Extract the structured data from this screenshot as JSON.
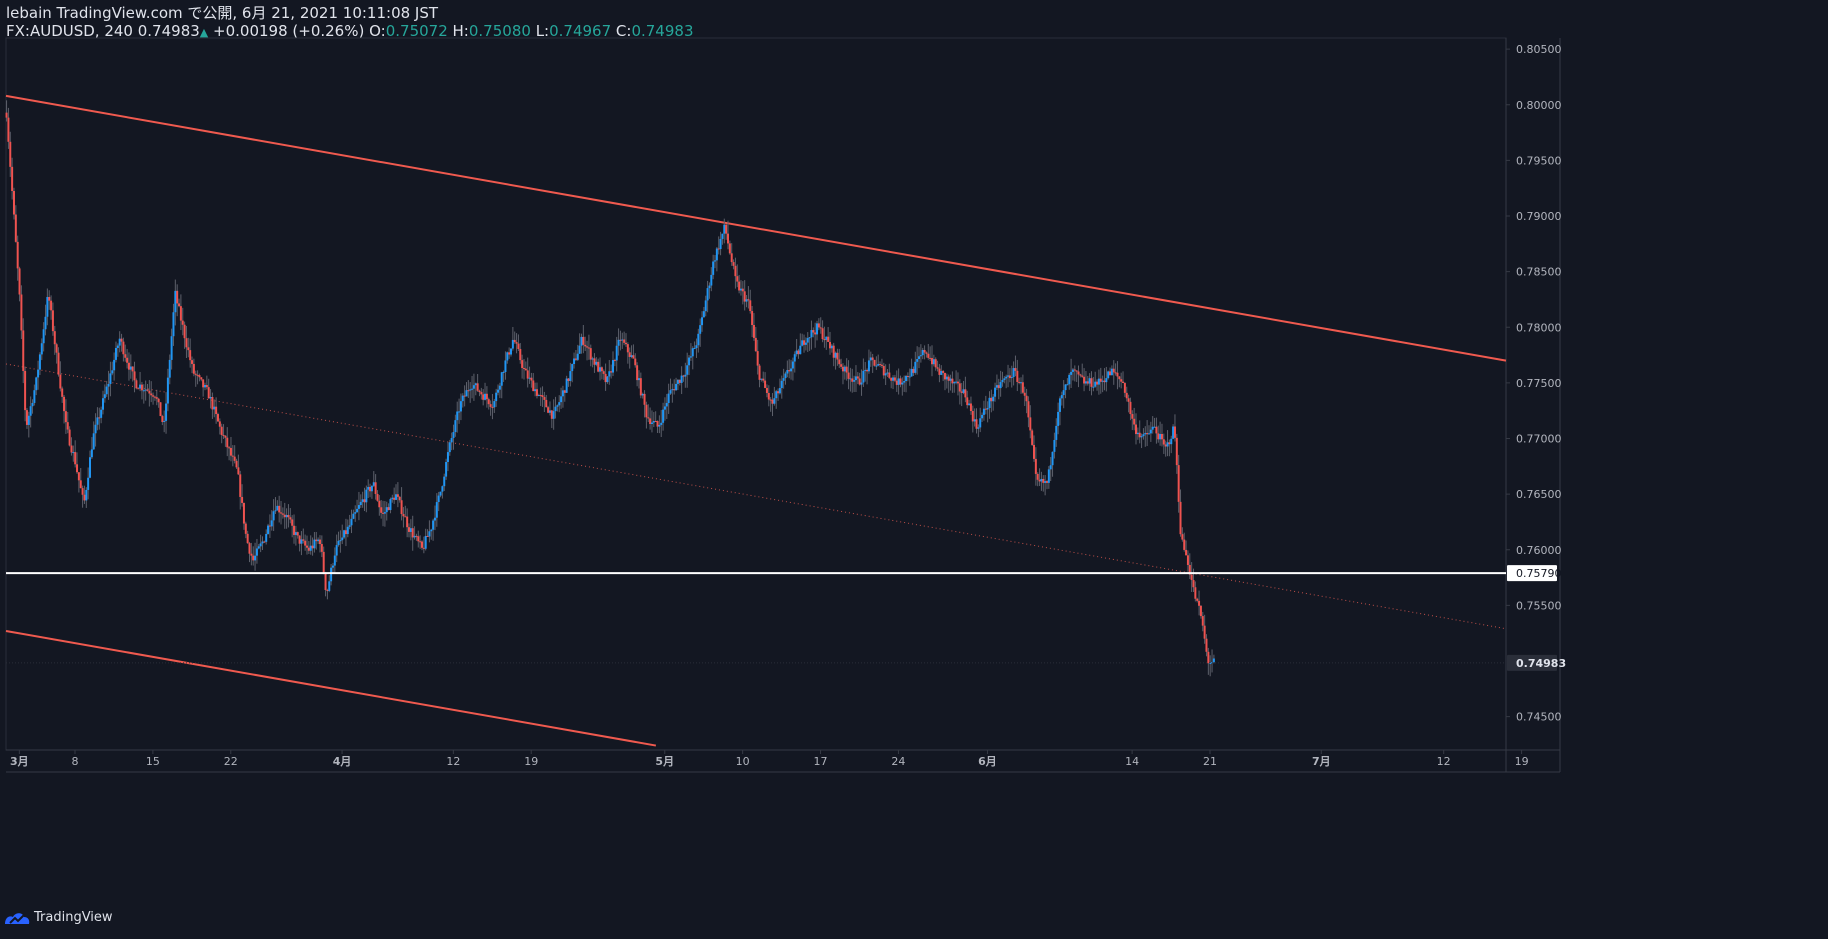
{
  "header": {
    "line1": "lebain TradingView.com で公開, 6月 21, 2021 10:11:08 JST",
    "symbol": "FX:AUDUSD, 240",
    "last": "0.74983",
    "change": "+0.00198 (+0.26%)",
    "o_label": "O:",
    "o_value": "0.75072",
    "h_label": "H:",
    "h_value": "0.75080",
    "l_label": "L:",
    "l_value": "0.74967",
    "c_label": "C:",
    "c_value": "0.74983"
  },
  "footer": {
    "brand": "TradingView"
  },
  "colors": {
    "background": "#131722",
    "up": "#2196f3",
    "down": "#ef5350",
    "trendline": "#f05a4f",
    "hline": "#ffffff",
    "axis_text": "#b2b5be"
  },
  "chart_data": {
    "type": "candlestick",
    "symbol": "FX:AUDUSD",
    "interval": "240",
    "ylim": [
      0.742,
      0.806
    ],
    "y_ticks": [
      "0.80500",
      "0.80000",
      "0.79500",
      "0.79000",
      "0.78500",
      "0.78000",
      "0.77500",
      "0.77000",
      "0.76500",
      "0.76000",
      "0.75500",
      "0.74500"
    ],
    "x_ticks": [
      {
        "label": "3月",
        "day": 0
      },
      {
        "label": "8",
        "day": 5
      },
      {
        "label": "15",
        "day": 12
      },
      {
        "label": "22",
        "day": 19
      },
      {
        "label": "4月",
        "day": 29
      },
      {
        "label": "12",
        "day": 39
      },
      {
        "label": "19",
        "day": 46
      },
      {
        "label": "5月",
        "day": 58
      },
      {
        "label": "10",
        "day": 65
      },
      {
        "label": "17",
        "day": 72
      },
      {
        "label": "24",
        "day": 79
      },
      {
        "label": "6月",
        "day": 87
      },
      {
        "label": "14",
        "day": 100
      },
      {
        "label": "21",
        "day": 107
      },
      {
        "label": "7月",
        "day": 117
      },
      {
        "label": "12",
        "day": 128
      },
      {
        "label": "19",
        "day": 135
      }
    ],
    "x_range_days": [
      -1.2,
      133.6
    ],
    "price_path": [
      {
        "day": -1.2,
        "p": 0.8
      },
      {
        "day": 0,
        "p": 0.783
      },
      {
        "day": 0.6,
        "p": 0.771
      },
      {
        "day": 1.5,
        "p": 0.775
      },
      {
        "day": 2.6,
        "p": 0.783
      },
      {
        "day": 3.4,
        "p": 0.777
      },
      {
        "day": 4.2,
        "p": 0.771
      },
      {
        "day": 5.0,
        "p": 0.768
      },
      {
        "day": 5.8,
        "p": 0.764
      },
      {
        "day": 6.6,
        "p": 0.77
      },
      {
        "day": 8.0,
        "p": 0.775
      },
      {
        "day": 9.0,
        "p": 0.779
      },
      {
        "day": 10.4,
        "p": 0.775
      },
      {
        "day": 12.2,
        "p": 0.774
      },
      {
        "day": 13.0,
        "p": 0.771
      },
      {
        "day": 14.0,
        "p": 0.783
      },
      {
        "day": 15.6,
        "p": 0.776
      },
      {
        "day": 17.0,
        "p": 0.774
      },
      {
        "day": 18.0,
        "p": 0.771
      },
      {
        "day": 19.6,
        "p": 0.767
      },
      {
        "day": 20.4,
        "p": 0.761
      },
      {
        "day": 21.0,
        "p": 0.759
      },
      {
        "day": 22.0,
        "p": 0.761
      },
      {
        "day": 23.0,
        "p": 0.764
      },
      {
        "day": 24.0,
        "p": 0.763
      },
      {
        "day": 25.0,
        "p": 0.761
      },
      {
        "day": 26.0,
        "p": 0.76
      },
      {
        "day": 27.0,
        "p": 0.761
      },
      {
        "day": 27.6,
        "p": 0.756
      },
      {
        "day": 28.4,
        "p": 0.76
      },
      {
        "day": 29.6,
        "p": 0.762
      },
      {
        "day": 30.6,
        "p": 0.764
      },
      {
        "day": 31.8,
        "p": 0.766
      },
      {
        "day": 32.6,
        "p": 0.763
      },
      {
        "day": 33.8,
        "p": 0.765
      },
      {
        "day": 35.0,
        "p": 0.762
      },
      {
        "day": 36.2,
        "p": 0.76
      },
      {
        "day": 37.0,
        "p": 0.762
      },
      {
        "day": 37.8,
        "p": 0.765
      },
      {
        "day": 38.6,
        "p": 0.769
      },
      {
        "day": 39.6,
        "p": 0.773
      },
      {
        "day": 40.6,
        "p": 0.775
      },
      {
        "day": 41.6,
        "p": 0.774
      },
      {
        "day": 42.6,
        "p": 0.773
      },
      {
        "day": 43.4,
        "p": 0.776
      },
      {
        "day": 44.4,
        "p": 0.779
      },
      {
        "day": 45.4,
        "p": 0.776
      },
      {
        "day": 46.6,
        "p": 0.774
      },
      {
        "day": 48.0,
        "p": 0.772
      },
      {
        "day": 49.2,
        "p": 0.775
      },
      {
        "day": 50.6,
        "p": 0.779
      },
      {
        "day": 51.6,
        "p": 0.777
      },
      {
        "day": 52.8,
        "p": 0.775
      },
      {
        "day": 54.0,
        "p": 0.779
      },
      {
        "day": 55.2,
        "p": 0.777
      },
      {
        "day": 56.4,
        "p": 0.772
      },
      {
        "day": 57.4,
        "p": 0.771
      },
      {
        "day": 58.4,
        "p": 0.774
      },
      {
        "day": 59.8,
        "p": 0.776
      },
      {
        "day": 61.0,
        "p": 0.779
      },
      {
        "day": 62.4,
        "p": 0.786
      },
      {
        "day": 63.4,
        "p": 0.789
      },
      {
        "day": 64.4,
        "p": 0.784
      },
      {
        "day": 65.6,
        "p": 0.782
      },
      {
        "day": 66.4,
        "p": 0.776
      },
      {
        "day": 67.6,
        "p": 0.773
      },
      {
        "day": 68.6,
        "p": 0.775
      },
      {
        "day": 69.6,
        "p": 0.777
      },
      {
        "day": 70.6,
        "p": 0.779
      },
      {
        "day": 71.8,
        "p": 0.78
      },
      {
        "day": 73.0,
        "p": 0.778
      },
      {
        "day": 74.2,
        "p": 0.776
      },
      {
        "day": 75.4,
        "p": 0.775
      },
      {
        "day": 76.6,
        "p": 0.777
      },
      {
        "day": 77.8,
        "p": 0.776
      },
      {
        "day": 79.0,
        "p": 0.775
      },
      {
        "day": 80.2,
        "p": 0.776
      },
      {
        "day": 81.4,
        "p": 0.778
      },
      {
        "day": 82.6,
        "p": 0.776
      },
      {
        "day": 83.8,
        "p": 0.775
      },
      {
        "day": 85.0,
        "p": 0.774
      },
      {
        "day": 86.0,
        "p": 0.771
      },
      {
        "day": 87.0,
        "p": 0.773
      },
      {
        "day": 88.2,
        "p": 0.775
      },
      {
        "day": 89.4,
        "p": 0.776
      },
      {
        "day": 90.4,
        "p": 0.774
      },
      {
        "day": 91.4,
        "p": 0.766
      },
      {
        "day": 92.4,
        "p": 0.766
      },
      {
        "day": 93.4,
        "p": 0.773
      },
      {
        "day": 94.6,
        "p": 0.776
      },
      {
        "day": 95.8,
        "p": 0.775
      },
      {
        "day": 97.0,
        "p": 0.775
      },
      {
        "day": 98.2,
        "p": 0.776
      },
      {
        "day": 99.2,
        "p": 0.775
      },
      {
        "day": 100.2,
        "p": 0.771
      },
      {
        "day": 101.0,
        "p": 0.77
      },
      {
        "day": 102.0,
        "p": 0.771
      },
      {
        "day": 103.0,
        "p": 0.769
      },
      {
        "day": 103.8,
        "p": 0.771
      },
      {
        "day": 104.4,
        "p": 0.761
      },
      {
        "day": 105.0,
        "p": 0.759
      },
      {
        "day": 105.6,
        "p": 0.756
      },
      {
        "day": 106.2,
        "p": 0.754
      },
      {
        "day": 106.8,
        "p": 0.75
      },
      {
        "day": 107.4,
        "p": 0.74983
      }
    ],
    "trendlines": [
      {
        "style": "solid",
        "from": {
          "day": -1.2,
          "p": 0.8008
        },
        "to": {
          "day": 133.6,
          "p": 0.777
        }
      },
      {
        "style": "solid",
        "from": {
          "day": -1.2,
          "p": 0.7527
        },
        "to": {
          "day": 57.2,
          "p": 0.7424
        }
      },
      {
        "style": "dotted",
        "from": {
          "day": -1.2,
          "p": 0.7767
        },
        "to": {
          "day": 133.6,
          "p": 0.7529
        }
      }
    ],
    "horizontal_line": {
      "value": 0.7579,
      "label": "0.75790"
    },
    "last_price": {
      "value": 0.74983,
      "label": "0.74983"
    }
  }
}
